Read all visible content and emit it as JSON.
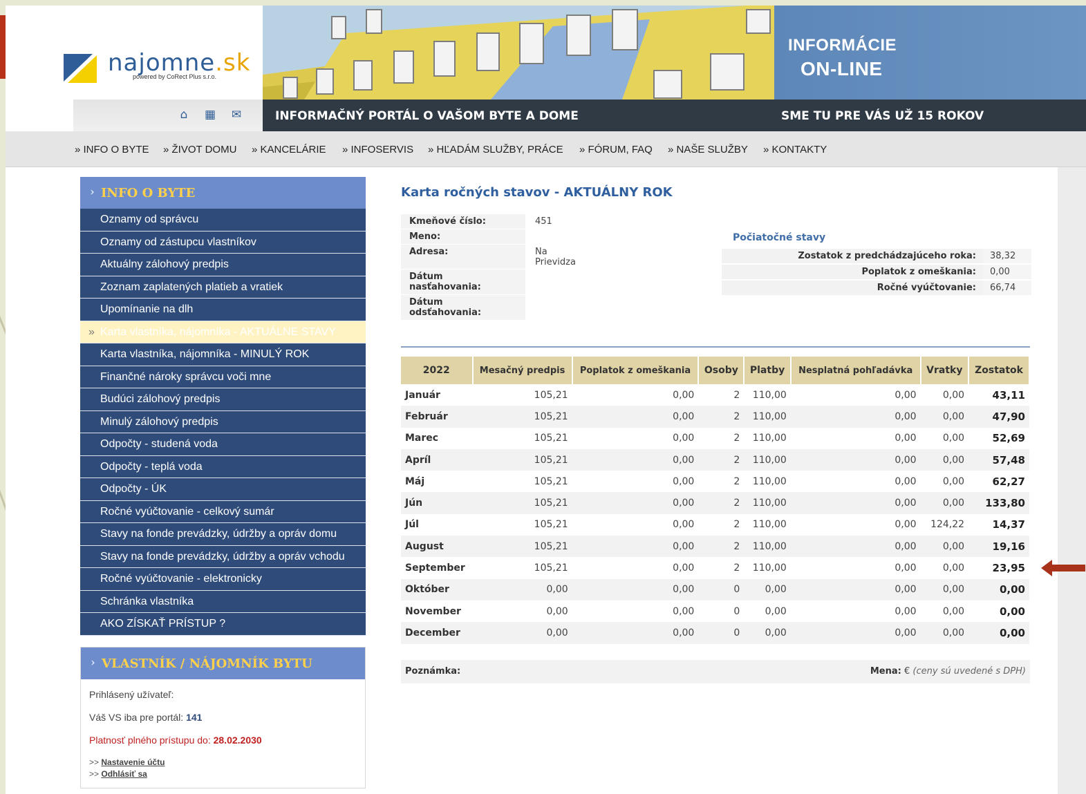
{
  "header": {
    "logo": {
      "name": "najomne",
      "tld": ".sk",
      "sub": "powered by CoRect Plus s.r.o."
    },
    "banner_line1": "INFORMÁCIE",
    "banner_line2": "ON-LINE",
    "portal_title": "INFORMAČNÝ PORTÁL O VAŠOM BYTE A DOME",
    "tagline": "SME TU PRE VÁS UŽ 15 ROKOV",
    "icons": [
      "home-icon",
      "building-icon",
      "mail-icon"
    ]
  },
  "nav": [
    "» INFO O BYTE",
    "» ŽIVOT DOMU",
    "» KANCELÁRIE",
    "» INFOSERVIS",
    "» HĽADÁM SLUŽBY, PRÁCE",
    "» FÓRUM, FAQ",
    "» NAŠE SLUŽBY",
    "» KONTAKTY"
  ],
  "sidebar": {
    "title": "INFO O BYTE",
    "items": [
      "Oznamy od správcu",
      "Oznamy od zástupcu vlastníkov",
      "Aktuálny zálohový predpis",
      "Zoznam zaplatených platieb a vratiek",
      "Upomínanie na dlh",
      "Karta vlastníka, nájomníka - AKTUÁLNE STAVY",
      "Karta vlastníka, nájomníka - MINULÝ ROK",
      "Finančné nároky správcu voči mne",
      "Budúci zálohový predpis",
      "Minulý zálohový predpis",
      "Odpočty - studená voda",
      "Odpočty - teplá voda",
      "Odpočty - ÚK",
      "Ročné vyúčtovanie - celkový sumár",
      "Stavy na fonde prevádzky, údržby a opráv domu",
      "Stavy na fonde prevádzky, údržby a opráv vchodu",
      "Ročné vyúčtovanie - elektronicky",
      "Schránka vlastníka",
      "AKO ZÍSKAŤ PRÍSTUP ?"
    ],
    "active_index": 5
  },
  "owner": {
    "title": "VLASTNÍK / NÁJOMNÍK BYTU",
    "logged_label": "Prihlásený užívateľ:",
    "vs_label": "Váš VS iba pre portál:",
    "vs_value": "141",
    "valid_label": "Platnosť plného prístupu do:",
    "valid_value": "28.02.2030",
    "links": [
      "Nastavenie účtu",
      "Odhlásiť sa"
    ]
  },
  "card": {
    "title": "Karta ročných stavov - AKTUÁLNY ROK",
    "fields": [
      {
        "label": "Kmeňové číslo:",
        "value": "451"
      },
      {
        "label": "Meno:",
        "value": ""
      },
      {
        "label": "Adresa:",
        "value": "Na\nPrievidza"
      },
      {
        "label": "Dátum nasťahovania:",
        "value": ""
      },
      {
        "label": "Dátum odsťahovania:",
        "value": ""
      }
    ],
    "initial_title": "Počiatočné stavy",
    "initial": [
      {
        "label": "Zostatok z predchádzajúceho roka:",
        "value": "38,32"
      },
      {
        "label": "Poplatok z omeškania:",
        "value": "0,00"
      },
      {
        "label": "Ročné vyúčtovanie:",
        "value": "66,74"
      }
    ]
  },
  "table": {
    "headers": [
      "2022",
      "Mesačný predpis",
      "Poplatok z omeškania",
      "Osoby",
      "Platby",
      "Nesplatná pohľadávka",
      "Vratky",
      "Zostatok"
    ],
    "rows": [
      [
        "Január",
        "105,21",
        "0,00",
        "2",
        "110,00",
        "0,00",
        "0,00",
        "43,11"
      ],
      [
        "Február",
        "105,21",
        "0,00",
        "2",
        "110,00",
        "0,00",
        "0,00",
        "47,90"
      ],
      [
        "Marec",
        "105,21",
        "0,00",
        "2",
        "110,00",
        "0,00",
        "0,00",
        "52,69"
      ],
      [
        "Apríl",
        "105,21",
        "0,00",
        "2",
        "110,00",
        "0,00",
        "0,00",
        "57,48"
      ],
      [
        "Máj",
        "105,21",
        "0,00",
        "2",
        "110,00",
        "0,00",
        "0,00",
        "62,27"
      ],
      [
        "Jún",
        "105,21",
        "0,00",
        "2",
        "110,00",
        "0,00",
        "0,00",
        "133,80"
      ],
      [
        "Júl",
        "105,21",
        "0,00",
        "2",
        "110,00",
        "0,00",
        "124,22",
        "14,37"
      ],
      [
        "August",
        "105,21",
        "0,00",
        "2",
        "110,00",
        "0,00",
        "0,00",
        "19,16"
      ],
      [
        "September",
        "105,21",
        "0,00",
        "2",
        "110,00",
        "0,00",
        "0,00",
        "23,95"
      ],
      [
        "Október",
        "0,00",
        "0,00",
        "0",
        "0,00",
        "0,00",
        "0,00",
        "0,00"
      ],
      [
        "November",
        "0,00",
        "0,00",
        "0",
        "0,00",
        "0,00",
        "0,00",
        "0,00"
      ],
      [
        "December",
        "0,00",
        "0,00",
        "0",
        "0,00",
        "0,00",
        "0,00",
        "0,00"
      ]
    ]
  },
  "note": {
    "label": "Poznámka:",
    "currency_label": "Mena:",
    "currency_value": "€",
    "vat_note": "(ceny sú uvedené s DPH)"
  },
  "colors": {
    "nav_blue": "#2e4b7a",
    "head_blue": "#6c8ccc",
    "accent_yellow": "#ffd04a",
    "table_header": "#e0d3a6",
    "arrow_red": "#a8321a"
  }
}
